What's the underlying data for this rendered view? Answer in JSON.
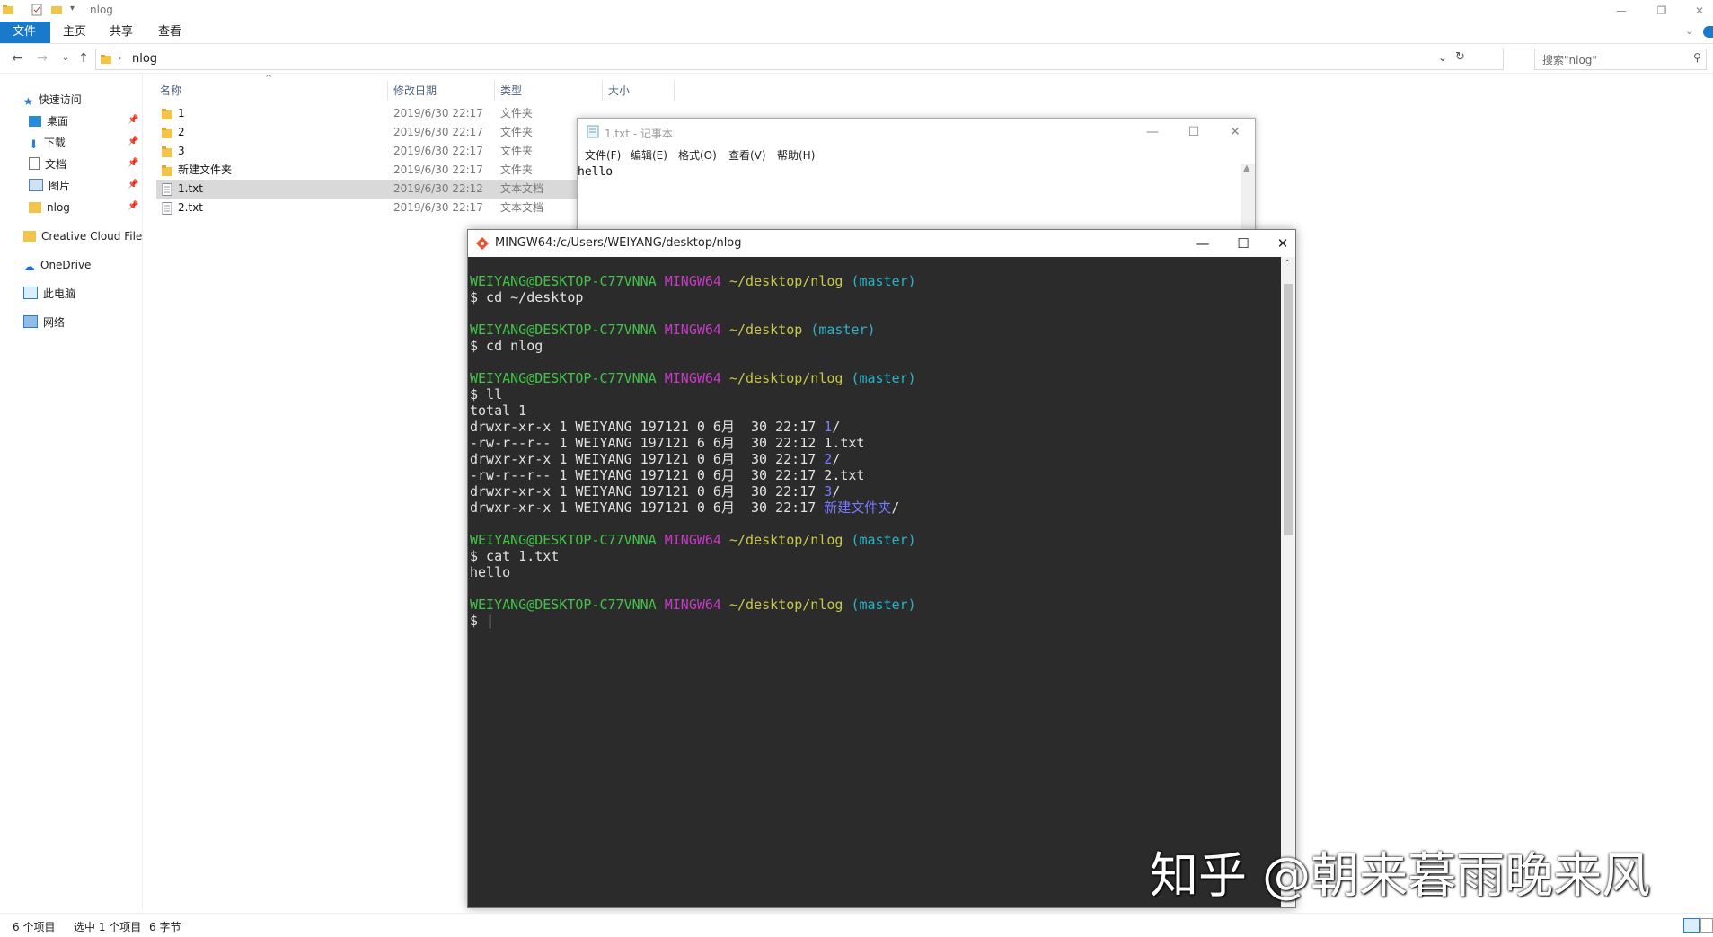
{
  "explorer": {
    "window_title": "nlog",
    "ribbon_tabs": [
      "文件",
      "主页",
      "共享",
      "查看"
    ],
    "address": "nlog",
    "search_placeholder": "搜索\"nlog\"",
    "sidebar": [
      {
        "label": "快速访问",
        "icon": "star-icon"
      },
      {
        "label": "桌面",
        "icon": "desktop-icon",
        "pinned": true
      },
      {
        "label": "下载",
        "icon": "download-icon",
        "pinned": true
      },
      {
        "label": "文档",
        "icon": "document-icon",
        "pinned": true
      },
      {
        "label": "图片",
        "icon": "picture-icon",
        "pinned": true
      },
      {
        "label": "nlog",
        "icon": "folder-icon",
        "pinned": true
      },
      {
        "label": "Creative Cloud Files",
        "icon": "cloud-folder-icon"
      },
      {
        "label": "OneDrive",
        "icon": "onedrive-icon"
      },
      {
        "label": "此电脑",
        "icon": "computer-icon"
      },
      {
        "label": "网络",
        "icon": "network-icon"
      }
    ],
    "columns": [
      "名称",
      "修改日期",
      "类型",
      "大小"
    ],
    "files": [
      {
        "name": "1",
        "date": "2019/6/30 22:17",
        "type": "文件夹",
        "kind": "folder"
      },
      {
        "name": "2",
        "date": "2019/6/30 22:17",
        "type": "文件夹",
        "kind": "folder"
      },
      {
        "name": "3",
        "date": "2019/6/30 22:17",
        "type": "文件夹",
        "kind": "folder"
      },
      {
        "name": "新建文件夹",
        "date": "2019/6/30 22:17",
        "type": "文件夹",
        "kind": "folder"
      },
      {
        "name": "1.txt",
        "date": "2019/6/30 22:12",
        "type": "文本文档",
        "kind": "txt",
        "selected": true
      },
      {
        "name": "2.txt",
        "date": "2019/6/30 22:17",
        "type": "文本文档",
        "kind": "txt"
      }
    ],
    "status": {
      "count": "6 个项目",
      "selected": "选中 1 个项目",
      "size": "6 字节"
    }
  },
  "notepad": {
    "title": "1.txt - 记事本",
    "menu": [
      "文件(F)",
      "编辑(E)",
      "格式(O)",
      "查看(V)",
      "帮助(H)"
    ],
    "content": "hello"
  },
  "terminal": {
    "title": "MINGW64:/c/Users/WEIYANG/desktop/nlog",
    "lines": [
      [
        {
          "t": "WEIYANG@DESKTOP-C77VNNA",
          "c": "user"
        },
        {
          "t": " "
        },
        {
          "t": "MINGW64",
          "c": "mag"
        },
        {
          "t": " "
        },
        {
          "t": "~/desktop/nlog",
          "c": "path"
        },
        {
          "t": " "
        },
        {
          "t": "(master)",
          "c": "branch"
        }
      ],
      [
        {
          "t": "$ cd ~/desktop"
        }
      ],
      [],
      [
        {
          "t": "WEIYANG@DESKTOP-C77VNNA",
          "c": "user"
        },
        {
          "t": " "
        },
        {
          "t": "MINGW64",
          "c": "mag"
        },
        {
          "t": " "
        },
        {
          "t": "~/desktop",
          "c": "path"
        },
        {
          "t": " "
        },
        {
          "t": "(master)",
          "c": "branch"
        }
      ],
      [
        {
          "t": "$ cd nlog"
        }
      ],
      [],
      [
        {
          "t": "WEIYANG@DESKTOP-C77VNNA",
          "c": "user"
        },
        {
          "t": " "
        },
        {
          "t": "MINGW64",
          "c": "mag"
        },
        {
          "t": " "
        },
        {
          "t": "~/desktop/nlog",
          "c": "path"
        },
        {
          "t": " "
        },
        {
          "t": "(master)",
          "c": "branch"
        }
      ],
      [
        {
          "t": "$ ll"
        }
      ],
      [
        {
          "t": "total 1"
        }
      ],
      [
        {
          "t": "drwxr-xr-x 1 WEIYANG 197121 0 6月  30 22:17 "
        },
        {
          "t": "1",
          "c": "dir"
        },
        {
          "t": "/"
        }
      ],
      [
        {
          "t": "-rw-r--r-- 1 WEIYANG 197121 6 6月  30 22:12 1.txt"
        }
      ],
      [
        {
          "t": "drwxr-xr-x 1 WEIYANG 197121 0 6月  30 22:17 "
        },
        {
          "t": "2",
          "c": "dir"
        },
        {
          "t": "/"
        }
      ],
      [
        {
          "t": "-rw-r--r-- 1 WEIYANG 197121 0 6月  30 22:17 2.txt"
        }
      ],
      [
        {
          "t": "drwxr-xr-x 1 WEIYANG 197121 0 6月  30 22:17 "
        },
        {
          "t": "3",
          "c": "dir"
        },
        {
          "t": "/"
        }
      ],
      [
        {
          "t": "drwxr-xr-x 1 WEIYANG 197121 0 6月  30 22:17 "
        },
        {
          "t": "新建文件夹",
          "c": "dir"
        },
        {
          "t": "/"
        }
      ],
      [],
      [
        {
          "t": "WEIYANG@DESKTOP-C77VNNA",
          "c": "user"
        },
        {
          "t": " "
        },
        {
          "t": "MINGW64",
          "c": "mag"
        },
        {
          "t": " "
        },
        {
          "t": "~/desktop/nlog",
          "c": "path"
        },
        {
          "t": " "
        },
        {
          "t": "(master)",
          "c": "branch"
        }
      ],
      [
        {
          "t": "$ cat 1.txt"
        }
      ],
      [
        {
          "t": "hello"
        }
      ],
      [],
      [
        {
          "t": "WEIYANG@DESKTOP-C77VNNA",
          "c": "user"
        },
        {
          "t": " "
        },
        {
          "t": "MINGW64",
          "c": "mag"
        },
        {
          "t": " "
        },
        {
          "t": "~/desktop/nlog",
          "c": "path"
        },
        {
          "t": " "
        },
        {
          "t": "(master)",
          "c": "branch"
        }
      ],
      [
        {
          "t": "$ |"
        }
      ]
    ]
  },
  "watermark": "知乎 @朝来暮雨晚来风",
  "colors": {
    "accent": "#1979ca",
    "user": "#44c34a",
    "host": "#c63bc6",
    "path": "#c8c84b",
    "branch": "#2bb3c7",
    "dir": "#7b7bff"
  }
}
